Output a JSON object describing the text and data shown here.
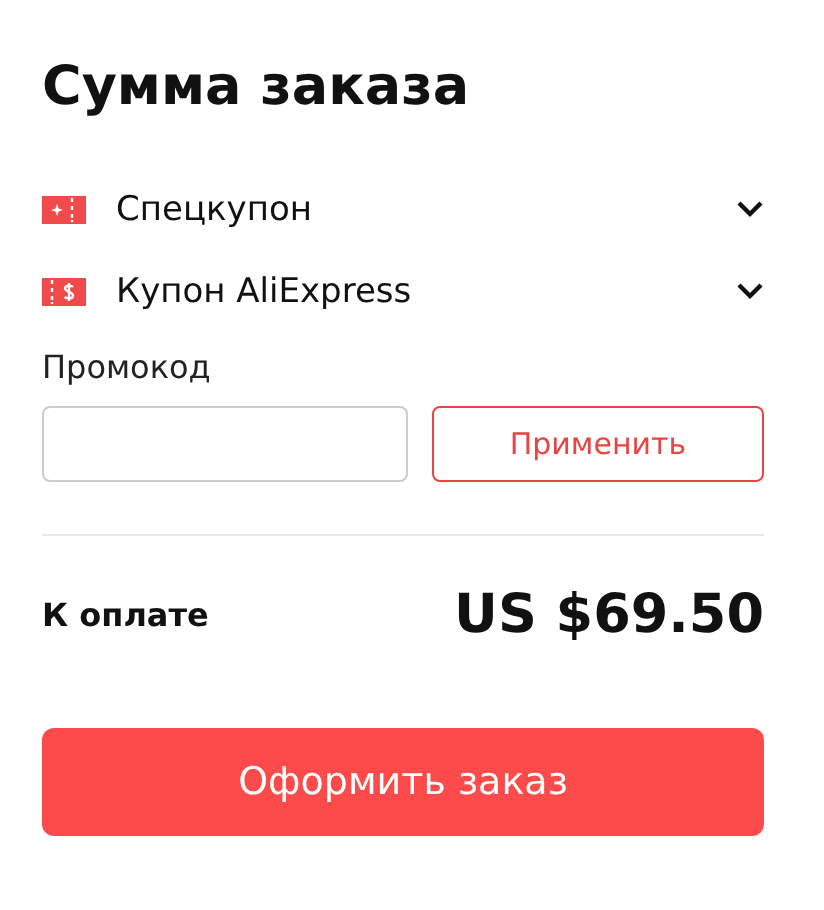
{
  "title": "Сумма заказа",
  "coupons": [
    {
      "kind": "special",
      "label": "Спецкупон",
      "expanded": false
    },
    {
      "kind": "dollar",
      "label": "Купон AliExpress",
      "expanded": false
    }
  ],
  "promo": {
    "label": "Промокод",
    "button": "Применить"
  },
  "total": {
    "label": "К оплате",
    "amount": "US $69.50"
  },
  "checkout_button": "Оформить заказ"
}
